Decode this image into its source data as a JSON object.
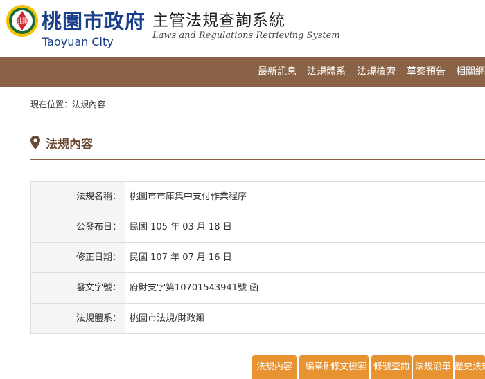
{
  "header": {
    "city_name": "桃園市政府",
    "city_name_en": "Taoyuan City",
    "system_name": "主管法規查詢系統",
    "system_name_en": "Laws and Regulations Retrieving System",
    "emblem_text": "桃園"
  },
  "nav": {
    "items": [
      {
        "label": "最新訊息"
      },
      {
        "label": "法規體系"
      },
      {
        "label": "法規檢索"
      },
      {
        "label": "草案預告"
      },
      {
        "label": "相關網站"
      }
    ]
  },
  "breadcrumb": "現在位置：法規內容",
  "section": {
    "title": "法規內容"
  },
  "info": {
    "rows": [
      {
        "label": "法規名稱：",
        "value": "桃園市市庫集中支付作業程序"
      },
      {
        "label": "公發布日：",
        "value": "民國 105 年 03 月 18 日"
      },
      {
        "label": "修正日期：",
        "value": "民國 107 年 07 月 16 日"
      },
      {
        "label": "發文字號：",
        "value": "府財支字第10701543941號 函"
      },
      {
        "label": "法規體系：",
        "value": "桃園市法規/財政類"
      }
    ]
  },
  "buttons": [
    {
      "label": "法規內容"
    },
    {
      "label": "編章節"
    },
    {
      "label": "條文檢索"
    },
    {
      "label": "條號查詢"
    },
    {
      "label": "法規沿革"
    },
    {
      "label": "歷史法規"
    }
  ],
  "colors": {
    "nav_bg": "#8a6245",
    "brand_blue": "#1a3f8a",
    "button_orange": "#e89331",
    "title_brown": "#6b4a33"
  }
}
